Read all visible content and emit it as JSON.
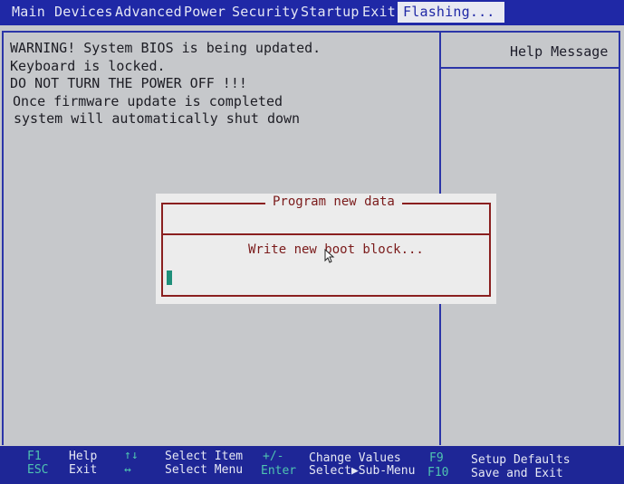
{
  "menu": {
    "items": [
      "Main",
      "Devices",
      "Advanced",
      "Power",
      "Security",
      "Startup",
      "Exit"
    ],
    "active": "Flashing..."
  },
  "warning": {
    "lines": [
      "WARNING! System BIOS is being updated.",
      "Keyboard is locked.",
      "DO NOT TURN THE POWER OFF !!!",
      "Once firmware update is completed",
      "system will automatically shut down"
    ]
  },
  "help": {
    "title": "Help Message"
  },
  "dialog": {
    "title": "Program new data",
    "message": "Write new boot block..."
  },
  "footer": {
    "f1_key": "F1",
    "f1_desc": "Help",
    "esc_key": "ESC",
    "esc_desc": "Exit",
    "updown_key": "↑↓",
    "updown_desc": "Select Item",
    "leftright_key": "↔",
    "leftright_desc": "Select Menu",
    "plusminus_key": "+/-",
    "plusminus_desc": "Change Values",
    "enter_key": "Enter",
    "enter_desc": "Select▶Sub-Menu",
    "f9_key": "F9",
    "f9_desc": "Setup Defaults",
    "f10_key": "F10",
    "f10_desc": "Save and Exit"
  },
  "colors": {
    "menubar": "#1f28a6",
    "dialog_text": "#7a1a1a",
    "key_text": "#4fc4b0"
  }
}
